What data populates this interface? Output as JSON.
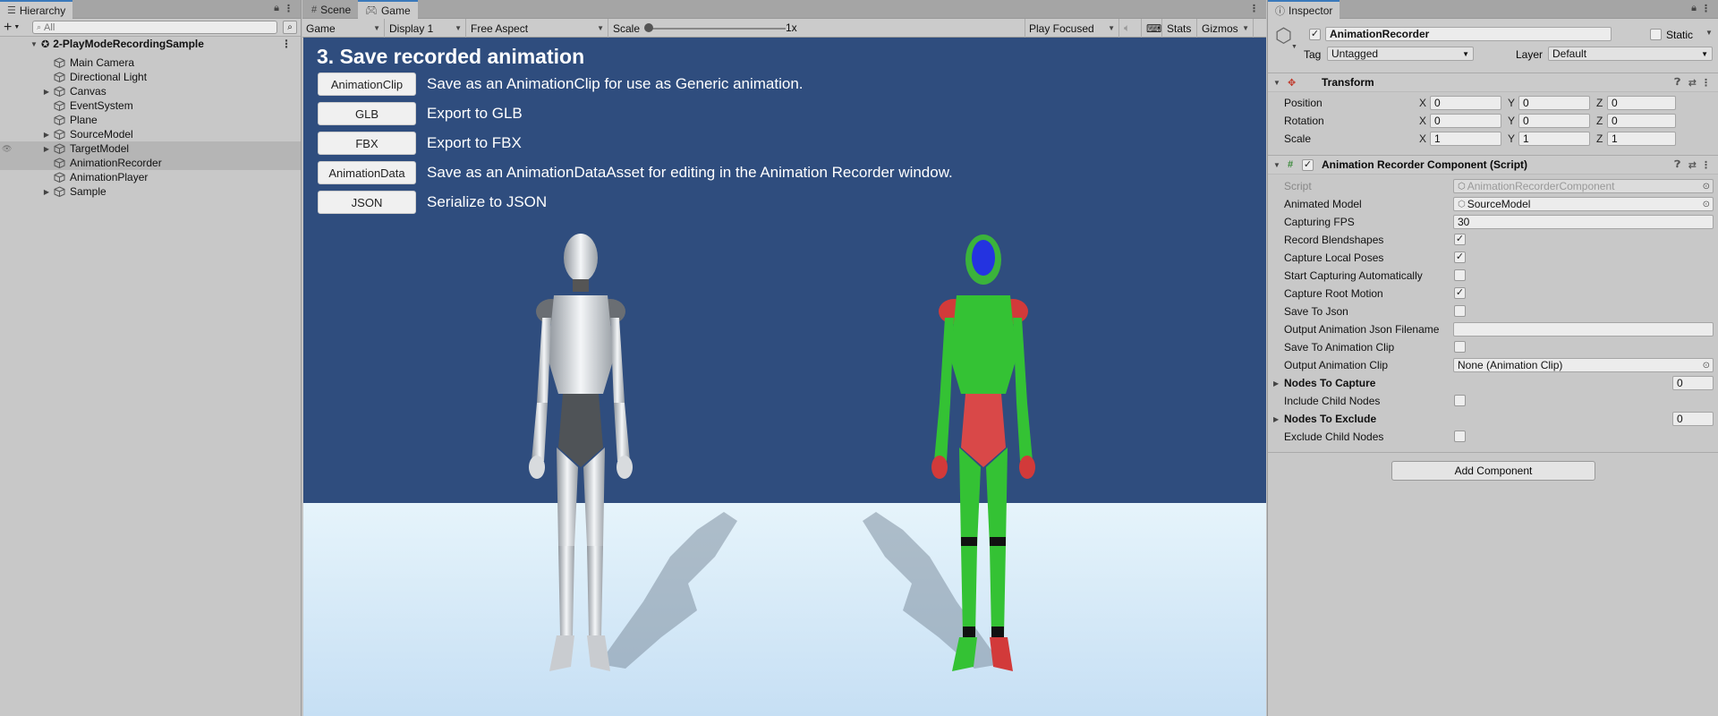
{
  "hierarchy": {
    "tab_label": "Hierarchy",
    "search_placeholder": "All",
    "scene_name": "2-PlayModeRecordingSample",
    "items": [
      {
        "label": "Main Camera"
      },
      {
        "label": "Directional Light"
      },
      {
        "label": "Canvas"
      },
      {
        "label": "EventSystem"
      },
      {
        "label": "Plane"
      },
      {
        "label": "SourceModel"
      },
      {
        "label": "TargetModel"
      },
      {
        "label": "AnimationRecorder"
      },
      {
        "label": "AnimationPlayer"
      },
      {
        "label": "Sample"
      }
    ]
  },
  "game": {
    "tabs": [
      {
        "label": "Scene"
      },
      {
        "label": "Game"
      }
    ],
    "toolbar": {
      "mode": "Game",
      "display": "Display 1",
      "aspect": "Free Aspect",
      "scale_label": "Scale",
      "scale_value": "1x",
      "play_focused": "Play Focused",
      "stats": "Stats",
      "gizmos": "Gizmos"
    },
    "title": "3. Save recorded animation",
    "buttons": [
      {
        "label": "AnimationClip",
        "desc": "Save as an AnimationClip for use as Generic animation."
      },
      {
        "label": "GLB",
        "desc": "Export to GLB"
      },
      {
        "label": "FBX",
        "desc": "Export to FBX"
      },
      {
        "label": "AnimationData",
        "desc": "Save as an AnimationDataAsset for editing in the Animation Recorder window."
      },
      {
        "label": "JSON",
        "desc": "Serialize to JSON"
      }
    ],
    "colors": {
      "sky": "#2f4d7e",
      "floor": "#dceefa"
    }
  },
  "inspector": {
    "tab_label": "Inspector",
    "object_name": "AnimationRecorder",
    "static_label": "Static",
    "tag_label": "Tag",
    "tag_value": "Untagged",
    "layer_label": "Layer",
    "layer_value": "Default",
    "transform": {
      "title": "Transform",
      "position": {
        "label": "Position",
        "x": "0",
        "y": "0",
        "z": "0"
      },
      "rotation": {
        "label": "Rotation",
        "x": "0",
        "y": "0",
        "z": "0"
      },
      "scale": {
        "label": "Scale",
        "x": "1",
        "y": "1",
        "z": "1"
      },
      "axis_x": "X",
      "axis_y": "Y",
      "axis_z": "Z"
    },
    "component": {
      "title": "Animation Recorder Component (Script)",
      "script_label": "Script",
      "script_value": "AnimationRecorderComponent",
      "animated_model_label": "Animated Model",
      "animated_model_value": "SourceModel",
      "capturing_fps_label": "Capturing FPS",
      "capturing_fps_value": "30",
      "record_blendshapes_label": "Record Blendshapes",
      "capture_local_poses_label": "Capture Local Poses",
      "start_capturing_label": "Start Capturing Automatically",
      "capture_root_motion_label": "Capture Root Motion",
      "save_to_json_label": "Save To Json",
      "output_json_label": "Output Animation Json Filename",
      "output_json_value": "",
      "save_to_clip_label": "Save To Animation Clip",
      "output_clip_label": "Output Animation Clip",
      "output_clip_value": "None (Animation Clip)",
      "nodes_to_capture_label": "Nodes To Capture",
      "nodes_to_capture_value": "0",
      "include_child_label": "Include Child Nodes",
      "nodes_to_exclude_label": "Nodes To Exclude",
      "nodes_to_exclude_value": "0",
      "exclude_child_label": "Exclude Child Nodes"
    },
    "add_component": "Add Component"
  }
}
